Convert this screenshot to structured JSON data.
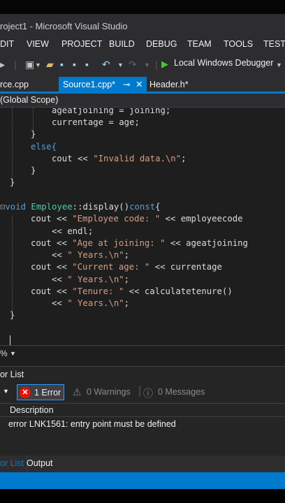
{
  "window": {
    "title": "roject1 - Microsoft Visual Studio"
  },
  "menu": [
    "DIT",
    "VIEW",
    "PROJECT",
    "BUILD",
    "DEBUG",
    "TEAM",
    "TOOLS",
    "TEST"
  ],
  "toolbar": {
    "debug_target": "Local Windows Debugger"
  },
  "tabs": {
    "left_partial": "rce.cpp",
    "active": "Source1.cpp*",
    "pin_glyph": "⊸",
    "close_glyph": "✕",
    "header": "Header.h*"
  },
  "scope": "(Global Scope)",
  "code_lines": [
    [
      "      ",
      [
        "",
        "ageatjoining = joining;"
      ]
    ],
    [
      "      ",
      [
        "",
        "currentage = age;"
      ]
    ]
  ],
  "editor": {
    "line1": "ageatjoining = joining;",
    "line2": "currentage = age;",
    "line3": "}",
    "line4": "else{",
    "line5a": "cout << ",
    "line5b": "\"Invalid data.\\n\"",
    "line5c": ";",
    "line6": "}",
    "line7": "}",
    "line8a": "void",
    "line8b": " Employee",
    "line8c": "::display()",
    "line8d": "const",
    "line8e": "{",
    "line9a": "cout << ",
    "line9b": "\"Employee code: \"",
    "line9c": " << employeecode",
    "line10": "<< endl;",
    "line11a": "cout << ",
    "line11b": "\"Age at joining: \"",
    "line11c": " << ageatjoining",
    "line12a": "<< ",
    "line12b": "\" Years.\\n\"",
    "line12c": ";",
    "line13a": "cout << ",
    "line13b": "\"Current age: \"",
    "line13c": " << currentage",
    "line14a": "<< ",
    "line14b": "\" Years.\\n\"",
    "line14c": ";",
    "line15a": "cout << ",
    "line15b": "\"Tenure: \"",
    "line15c": " << calculatetenure()",
    "line16a": "<< ",
    "line16b": "\" Years.\\n\"",
    "line16c": ";",
    "line17": "}"
  },
  "zoom": "%",
  "error_list": {
    "title": "or List",
    "errors_label": "1 Error",
    "warnings_label": "0 Warnings",
    "messages_label": "0 Messages",
    "column_description": "Description",
    "rows": [
      "error LNK1561: entry point must be defined"
    ]
  },
  "bottom_tabs": {
    "error_list": "or List",
    "output": "Output"
  },
  "colors": {
    "accent": "#007acc",
    "keyword": "#569cd6",
    "string": "#d69d85",
    "error": "#e51400"
  }
}
